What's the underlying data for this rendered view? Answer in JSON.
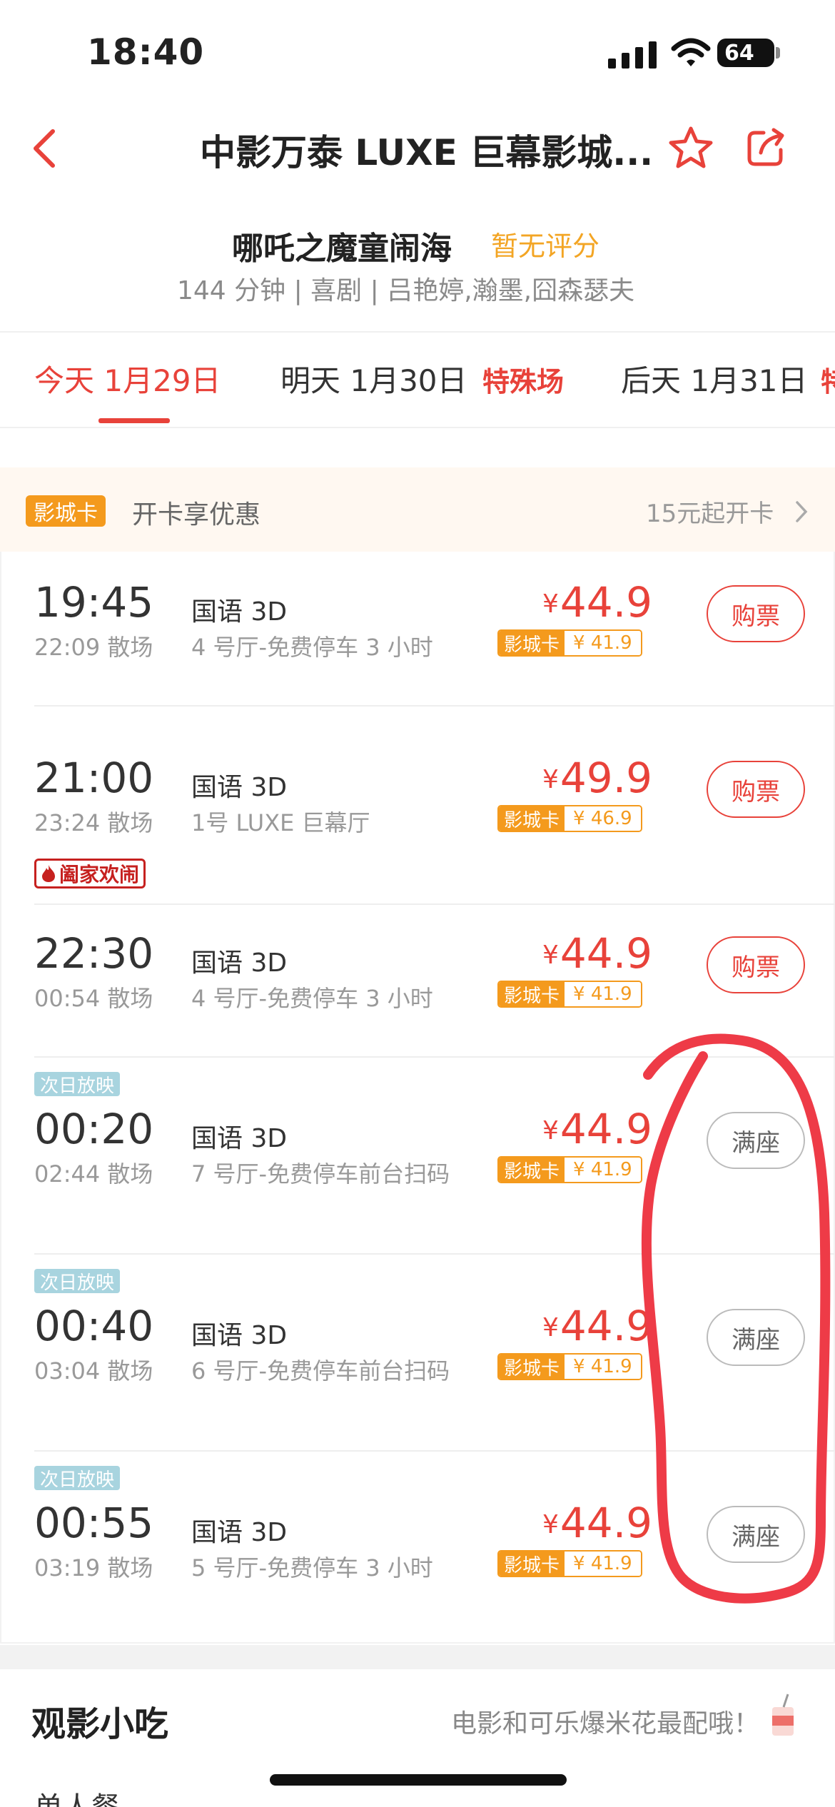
{
  "status_bar": {
    "time": "18:40",
    "battery": "64"
  },
  "nav": {
    "title": "中影万泰 LUXE 巨幕影城..."
  },
  "movie": {
    "title": "哪吒之魔童闹海",
    "rating": "暂无评分",
    "meta": "144 分钟 | 喜剧 | 吕艳婷,瀚墨,囧森瑟夫"
  },
  "date_tabs": [
    {
      "label": "今天 1月29日"
    },
    {
      "label": "明天 1月30日",
      "tag": "特殊场"
    },
    {
      "label": "后天 1月31日",
      "tag": "特"
    }
  ],
  "promo": {
    "badge": "影城卡",
    "text": "开卡享优惠",
    "right": "15元起开卡"
  },
  "showtimes": [
    {
      "start": "19:45",
      "end": "22:09 散场",
      "lang": "国语 3D",
      "hall": "4 号厅-免费停车 3 小时",
      "price": "44.9",
      "card_label": "影城卡",
      "card_price": "¥ 41.9",
      "action": "购票"
    },
    {
      "start": "21:00",
      "end": "23:24 散场",
      "lang": "国语 3D",
      "hall": "1号 LUXE 巨幕厅",
      "price": "49.9",
      "card_label": "影城卡",
      "card_price": "¥ 46.9",
      "action": "购票",
      "festival_tag": "阖家欢闹"
    },
    {
      "start": "22:30",
      "end": "00:54 散场",
      "lang": "国语 3D",
      "hall": "4 号厅-免费停车 3 小时",
      "price": "44.9",
      "card_label": "影城卡",
      "card_price": "¥ 41.9",
      "action": "购票"
    },
    {
      "next_day": "次日放映",
      "start": "00:20",
      "end": "02:44 散场",
      "lang": "国语 3D",
      "hall": "7 号厅-免费停车前台扫码",
      "price": "44.9",
      "card_label": "影城卡",
      "card_price": "¥ 41.9",
      "action": "满座"
    },
    {
      "next_day": "次日放映",
      "start": "00:40",
      "end": "03:04 散场",
      "lang": "国语 3D",
      "hall": "6 号厅-免费停车前台扫码",
      "price": "44.9",
      "card_label": "影城卡",
      "card_price": "¥ 41.9",
      "action": "满座"
    },
    {
      "next_day": "次日放映",
      "start": "00:55",
      "end": "03:19 散场",
      "lang": "国语 3D",
      "hall": "5 号厅-免费停车 3 小时",
      "price": "44.9",
      "card_label": "影城卡",
      "card_price": "¥ 41.9",
      "action": "满座"
    }
  ],
  "currency": "¥",
  "snacks": {
    "title": "观影小吃",
    "subtitle": "电影和可乐爆米花最配哦！",
    "first_item": "单人餐"
  },
  "colors": {
    "accent": "#e8423a",
    "card": "#f49a1d",
    "next_day": "#a8d4df"
  }
}
